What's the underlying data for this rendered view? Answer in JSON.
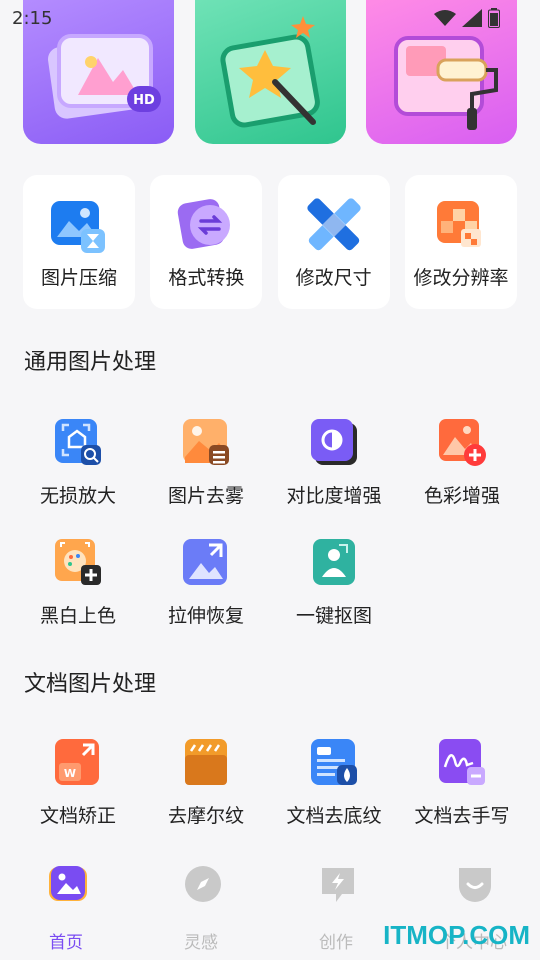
{
  "status": {
    "time": "2:15"
  },
  "tools": [
    {
      "label": "图片压缩",
      "icon": "image-compress-icon"
    },
    {
      "label": "格式转换",
      "icon": "format-convert-icon"
    },
    {
      "label": "修改尺寸",
      "icon": "resize-icon"
    },
    {
      "label": "修改分辨率",
      "icon": "resolution-icon"
    }
  ],
  "sections": {
    "general": {
      "title": "通用图片处理",
      "items": [
        {
          "label": "无损放大",
          "icon": "lossless-upscale-icon"
        },
        {
          "label": "图片去雾",
          "icon": "dehaze-icon"
        },
        {
          "label": "对比度增强",
          "icon": "contrast-icon"
        },
        {
          "label": "色彩增强",
          "icon": "color-enhance-icon"
        },
        {
          "label": "黑白上色",
          "icon": "colorize-icon"
        },
        {
          "label": "拉伸恢复",
          "icon": "stretch-restore-icon"
        },
        {
          "label": "一键抠图",
          "icon": "cutout-icon"
        }
      ]
    },
    "document": {
      "title": "文档图片处理",
      "items": [
        {
          "label": "文档矫正",
          "icon": "doc-correct-icon"
        },
        {
          "label": "去摩尔纹",
          "icon": "moire-remove-icon"
        },
        {
          "label": "文档去底纹",
          "icon": "doc-background-remove-icon"
        },
        {
          "label": "文档去手写",
          "icon": "handwriting-remove-icon"
        }
      ]
    }
  },
  "tabbar": [
    {
      "label": "首页",
      "active": true
    },
    {
      "label": "灵感",
      "active": false
    },
    {
      "label": "创作",
      "active": false
    },
    {
      "label": "个人中心",
      "active": false
    }
  ],
  "watermark": "ITMOP.COM",
  "colors": {
    "accent": "#7a4cf2",
    "background": "#f6f6f8"
  }
}
